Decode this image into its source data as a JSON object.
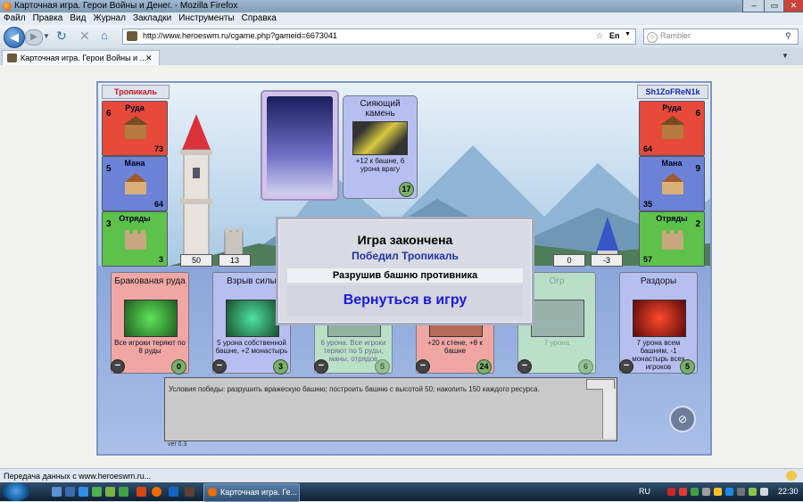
{
  "window": {
    "title": "Карточная игра. Герои Войны и Денег. - Mozilla Firefox"
  },
  "menu": [
    "Файл",
    "Правка",
    "Вид",
    "Журнал",
    "Закладки",
    "Инструменты",
    "Справка"
  ],
  "nav": {
    "url": "http://www.heroeswm.ru/cgame.php?gameid=6673041",
    "lang": "En",
    "search_placeholder": "Rambler"
  },
  "tab": {
    "title": "Карточная игра. Герои Войны и ..."
  },
  "game": {
    "player_left": {
      "name": "Тропикаль",
      "resources": [
        {
          "name": "Руда",
          "level": "6",
          "amount": "73",
          "color": "#e84a3a"
        },
        {
          "name": "Мана",
          "level": "5",
          "amount": "64",
          "color": "#6b82d6"
        },
        {
          "name": "Отряды",
          "level": "3",
          "amount": "3",
          "color": "#5cc24a"
        }
      ],
      "tower": "50",
      "wall": "13"
    },
    "player_right": {
      "name": "Sh1ZoFReN1k",
      "resources": [
        {
          "name": "Руда",
          "level": "6",
          "amount": "64",
          "color": "#e84a3a"
        },
        {
          "name": "Мана",
          "level": "9",
          "amount": "35",
          "color": "#6b82d6"
        },
        {
          "name": "Отряды",
          "level": "2",
          "amount": "57",
          "color": "#5cc24a"
        }
      ],
      "tower": "0",
      "wall": "-3"
    },
    "played_card": {
      "name": "Сияющий камень",
      "desc": "+12 к башне, 6 урона врагу",
      "cost": "17"
    },
    "hand": [
      {
        "name": "Бракованая руда",
        "desc": "Все игроки теряют по 8 руды",
        "cost": "0",
        "color": "#f0a7a4"
      },
      {
        "name": "Взрыв силы",
        "desc": "5 урона собственной башне, +2 монастырь",
        "cost": "3",
        "color": "#b7bff0"
      },
      {
        "name": "",
        "desc": "6 урона. Все игроки теряют по 5 руды, маны, отрядов",
        "cost": "5",
        "color": "#c6f0c0"
      },
      {
        "name": "",
        "desc": "+20 к стене, +8 к башне",
        "cost": "24",
        "color": "#f0a7a4"
      },
      {
        "name": "Огр",
        "desc": "7 урона",
        "cost": "6",
        "color": "#c6f0c0"
      },
      {
        "name": "Раздоры",
        "desc": "7 урона всем башням, -1 монастырь всех игроков",
        "cost": "5",
        "color": "#b7bff0"
      }
    ],
    "log": "Условия победы: разрушить вражескую башню; построить башню с высотой 50; накопить 150 каждого ресурса.",
    "version": "ver 0.3",
    "dialog": {
      "title": "Игра закончена",
      "winner": "Победил Тропикаль",
      "reason": "Разрушив башню противника",
      "button": "Вернуться в игру"
    }
  },
  "status": {
    "text": "Передача данных с www.heroeswm.ru..."
  },
  "taskbar": {
    "task_title": "Карточная игра. Ге...",
    "lang": "RU",
    "clock": "22:30"
  }
}
